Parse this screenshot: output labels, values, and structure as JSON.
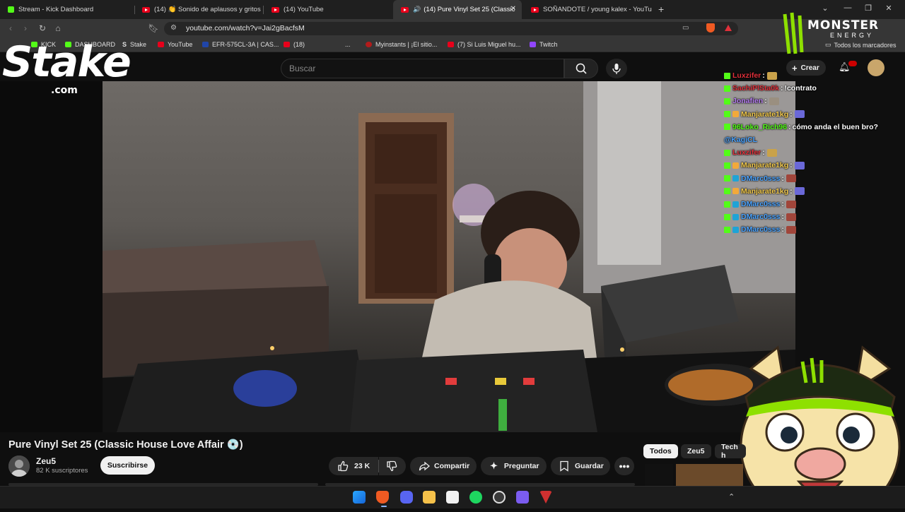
{
  "browser": {
    "tabs": [
      {
        "label": "Stream - Kick Dashboard",
        "favicon": "kick-icon"
      },
      {
        "label": "(14) 👏 Sonido de aplausos y gritos d",
        "favicon": "youtube-icon"
      },
      {
        "label": "(14) YouTube",
        "favicon": "youtube-icon"
      },
      {
        "label": "(14) Pure Vinyl Set 25 (Classic",
        "favicon": "youtube-icon",
        "active": true
      },
      {
        "label": "SOÑANDOTE / young kalex - YouTub",
        "favicon": "youtube-icon"
      }
    ],
    "new_tab": "+",
    "url": "youtube.com/watch?v=Jai2gBacfsM",
    "bookmarks": [
      {
        "label": "KICK",
        "icon": "kick-icon"
      },
      {
        "label": "DASHBOARD",
        "icon": "kick-icon"
      },
      {
        "label": "Stake",
        "icon": "stake-icon"
      },
      {
        "label": "YouTube",
        "icon": "youtube-icon"
      },
      {
        "label": "EFR-575CL-3A | CAS...",
        "icon": "casio-icon"
      },
      {
        "label": "(18)",
        "icon": "youtube-icon"
      },
      {
        "label": "...",
        "icon": ""
      },
      {
        "label": "Myinstants | ¡El sitio...",
        "icon": "myinstants-icon"
      },
      {
        "label": "(7) Si Luis Miguel hu...",
        "icon": "youtube-icon"
      },
      {
        "label": "Twitch",
        "icon": "twitch-icon"
      }
    ],
    "all_bookmarks": "Todos los marcadores"
  },
  "youtube": {
    "search_placeholder": "Buscar",
    "create_label": "Crear",
    "video_title": "Pure Vinyl Set 25 (Classic House Love Affair 💿)",
    "channel_name": "Zeu5",
    "subscribers": "82 K suscriptores",
    "subscribe_label": "Suscribirse",
    "likes": "23 K",
    "share_label": "Compartir",
    "ask_label": "Preguntar",
    "save_label": "Guardar",
    "chips": [
      "Todos",
      "Zeu5",
      "Tech h"
    ]
  },
  "overlay": {
    "stake_logo": "Stake",
    "stake_domain": ".com",
    "monster_logo": "MONSTER",
    "monster_sub": "ENERGY"
  },
  "chat": [
    {
      "user": "Luxzifer",
      "color": "#e0303a",
      "message": "",
      "emote": "#c9a24a"
    },
    {
      "user": "SachiPlSta0k",
      "color": "#e0303a",
      "message": "!contrato",
      "emote": ""
    },
    {
      "user": "Jonafien",
      "color": "#b57cf0",
      "message": "",
      "emote": "#9a8f80"
    },
    {
      "user": "Manjarate1kg",
      "color": "#f2c94c",
      "message": "",
      "emote": "#6a68d8"
    },
    {
      "user": "96Loko_Rich96",
      "color": "#53fc18",
      "message": "cómo anda el buen bro?",
      "emote": ""
    },
    {
      "user": "@KagiCL",
      "color": "#4aa3ff",
      "message": "",
      "emote": ""
    },
    {
      "user": "Luxzifer",
      "color": "#e0303a",
      "message": "",
      "emote": "#c9a24a"
    },
    {
      "user": "Manjarate1kg",
      "color": "#f2c94c",
      "message": "",
      "emote": "#6a68d8"
    },
    {
      "user": "DMarc0sss",
      "color": "#4aa3ff",
      "message": "",
      "emote": "#a0453a"
    },
    {
      "user": "Manjarate1kg",
      "color": "#f2c94c",
      "message": "",
      "emote": "#6a68d8"
    },
    {
      "user": "DMarc0sss",
      "color": "#4aa3ff",
      "message": "",
      "emote": "#a0453a"
    },
    {
      "user": "DMarc0sss",
      "color": "#4aa3ff",
      "message": "",
      "emote": "#a0453a"
    },
    {
      "user": "DMarc0sss",
      "color": "#4aa3ff",
      "message": "",
      "emote": "#a0453a"
    }
  ],
  "colors": {
    "accent_kick": "#53fc18",
    "youtube_red": "#e8001b",
    "monster_green": "#8ee000"
  }
}
